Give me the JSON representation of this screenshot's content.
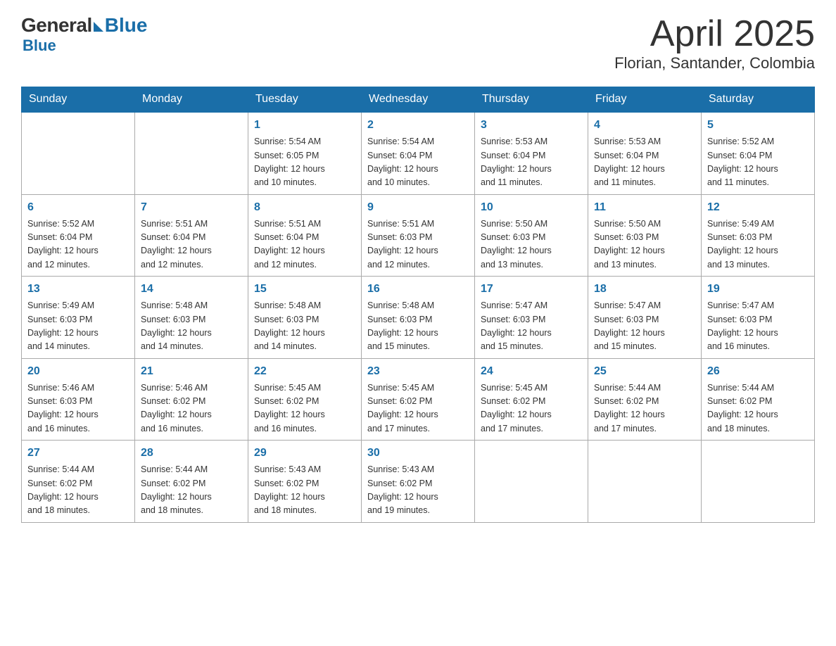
{
  "logo": {
    "general": "General",
    "blue": "Blue"
  },
  "header": {
    "month": "April 2025",
    "location": "Florian, Santander, Colombia"
  },
  "days_of_week": [
    "Sunday",
    "Monday",
    "Tuesday",
    "Wednesday",
    "Thursday",
    "Friday",
    "Saturday"
  ],
  "weeks": [
    [
      {
        "day": "",
        "info": ""
      },
      {
        "day": "",
        "info": ""
      },
      {
        "day": "1",
        "info": "Sunrise: 5:54 AM\nSunset: 6:05 PM\nDaylight: 12 hours\nand 10 minutes."
      },
      {
        "day": "2",
        "info": "Sunrise: 5:54 AM\nSunset: 6:04 PM\nDaylight: 12 hours\nand 10 minutes."
      },
      {
        "day": "3",
        "info": "Sunrise: 5:53 AM\nSunset: 6:04 PM\nDaylight: 12 hours\nand 11 minutes."
      },
      {
        "day": "4",
        "info": "Sunrise: 5:53 AM\nSunset: 6:04 PM\nDaylight: 12 hours\nand 11 minutes."
      },
      {
        "day": "5",
        "info": "Sunrise: 5:52 AM\nSunset: 6:04 PM\nDaylight: 12 hours\nand 11 minutes."
      }
    ],
    [
      {
        "day": "6",
        "info": "Sunrise: 5:52 AM\nSunset: 6:04 PM\nDaylight: 12 hours\nand 12 minutes."
      },
      {
        "day": "7",
        "info": "Sunrise: 5:51 AM\nSunset: 6:04 PM\nDaylight: 12 hours\nand 12 minutes."
      },
      {
        "day": "8",
        "info": "Sunrise: 5:51 AM\nSunset: 6:04 PM\nDaylight: 12 hours\nand 12 minutes."
      },
      {
        "day": "9",
        "info": "Sunrise: 5:51 AM\nSunset: 6:03 PM\nDaylight: 12 hours\nand 12 minutes."
      },
      {
        "day": "10",
        "info": "Sunrise: 5:50 AM\nSunset: 6:03 PM\nDaylight: 12 hours\nand 13 minutes."
      },
      {
        "day": "11",
        "info": "Sunrise: 5:50 AM\nSunset: 6:03 PM\nDaylight: 12 hours\nand 13 minutes."
      },
      {
        "day": "12",
        "info": "Sunrise: 5:49 AM\nSunset: 6:03 PM\nDaylight: 12 hours\nand 13 minutes."
      }
    ],
    [
      {
        "day": "13",
        "info": "Sunrise: 5:49 AM\nSunset: 6:03 PM\nDaylight: 12 hours\nand 14 minutes."
      },
      {
        "day": "14",
        "info": "Sunrise: 5:48 AM\nSunset: 6:03 PM\nDaylight: 12 hours\nand 14 minutes."
      },
      {
        "day": "15",
        "info": "Sunrise: 5:48 AM\nSunset: 6:03 PM\nDaylight: 12 hours\nand 14 minutes."
      },
      {
        "day": "16",
        "info": "Sunrise: 5:48 AM\nSunset: 6:03 PM\nDaylight: 12 hours\nand 15 minutes."
      },
      {
        "day": "17",
        "info": "Sunrise: 5:47 AM\nSunset: 6:03 PM\nDaylight: 12 hours\nand 15 minutes."
      },
      {
        "day": "18",
        "info": "Sunrise: 5:47 AM\nSunset: 6:03 PM\nDaylight: 12 hours\nand 15 minutes."
      },
      {
        "day": "19",
        "info": "Sunrise: 5:47 AM\nSunset: 6:03 PM\nDaylight: 12 hours\nand 16 minutes."
      }
    ],
    [
      {
        "day": "20",
        "info": "Sunrise: 5:46 AM\nSunset: 6:03 PM\nDaylight: 12 hours\nand 16 minutes."
      },
      {
        "day": "21",
        "info": "Sunrise: 5:46 AM\nSunset: 6:02 PM\nDaylight: 12 hours\nand 16 minutes."
      },
      {
        "day": "22",
        "info": "Sunrise: 5:45 AM\nSunset: 6:02 PM\nDaylight: 12 hours\nand 16 minutes."
      },
      {
        "day": "23",
        "info": "Sunrise: 5:45 AM\nSunset: 6:02 PM\nDaylight: 12 hours\nand 17 minutes."
      },
      {
        "day": "24",
        "info": "Sunrise: 5:45 AM\nSunset: 6:02 PM\nDaylight: 12 hours\nand 17 minutes."
      },
      {
        "day": "25",
        "info": "Sunrise: 5:44 AM\nSunset: 6:02 PM\nDaylight: 12 hours\nand 17 minutes."
      },
      {
        "day": "26",
        "info": "Sunrise: 5:44 AM\nSunset: 6:02 PM\nDaylight: 12 hours\nand 18 minutes."
      }
    ],
    [
      {
        "day": "27",
        "info": "Sunrise: 5:44 AM\nSunset: 6:02 PM\nDaylight: 12 hours\nand 18 minutes."
      },
      {
        "day": "28",
        "info": "Sunrise: 5:44 AM\nSunset: 6:02 PM\nDaylight: 12 hours\nand 18 minutes."
      },
      {
        "day": "29",
        "info": "Sunrise: 5:43 AM\nSunset: 6:02 PM\nDaylight: 12 hours\nand 18 minutes."
      },
      {
        "day": "30",
        "info": "Sunrise: 5:43 AM\nSunset: 6:02 PM\nDaylight: 12 hours\nand 19 minutes."
      },
      {
        "day": "",
        "info": ""
      },
      {
        "day": "",
        "info": ""
      },
      {
        "day": "",
        "info": ""
      }
    ]
  ]
}
